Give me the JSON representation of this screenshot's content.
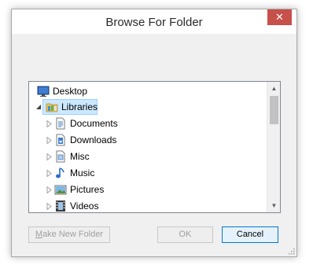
{
  "window": {
    "title": "Browse For Folder",
    "close_glyph": "✕"
  },
  "tree": {
    "items": [
      {
        "label": "Desktop",
        "icon": "desktop-icon",
        "expander": "none",
        "level": 0,
        "selected": false
      },
      {
        "label": "Libraries",
        "icon": "libraries-folder-icon",
        "expander": "expanded",
        "level": 0,
        "selected": true
      },
      {
        "label": "Documents",
        "icon": "documents-icon",
        "expander": "collapsed",
        "level": 1,
        "selected": false
      },
      {
        "label": "Downloads",
        "icon": "downloads-icon",
        "expander": "collapsed",
        "level": 1,
        "selected": false
      },
      {
        "label": "Misc",
        "icon": "misc-icon",
        "expander": "collapsed",
        "level": 1,
        "selected": false
      },
      {
        "label": "Music",
        "icon": "music-icon",
        "expander": "collapsed",
        "level": 1,
        "selected": false
      },
      {
        "label": "Pictures",
        "icon": "pictures-icon",
        "expander": "collapsed",
        "level": 1,
        "selected": false
      },
      {
        "label": "Videos",
        "icon": "videos-icon",
        "expander": "collapsed",
        "level": 1,
        "selected": false
      }
    ]
  },
  "buttons": {
    "make_new_folder": "Make New Folder",
    "ok": "OK",
    "cancel": "Cancel"
  },
  "colors": {
    "close_button": "#c7504b",
    "selection_fill": "#cce8ff",
    "selection_border": "#99d1ff",
    "default_button_border": "#0078d7"
  }
}
